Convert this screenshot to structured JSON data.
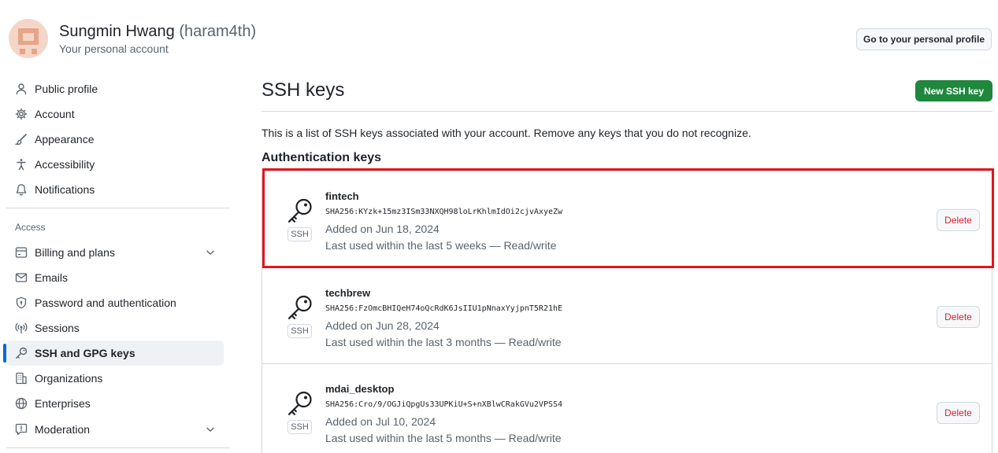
{
  "header": {
    "display_name": "Sungmin Hwang",
    "handle": "(haram4th)",
    "subtitle": "Your personal account",
    "profile_button": "Go to your personal profile"
  },
  "sidebar": {
    "items_top": [
      {
        "label": "Public profile",
        "icon": "person-icon"
      },
      {
        "label": "Account",
        "icon": "gear-icon"
      },
      {
        "label": "Appearance",
        "icon": "paintbrush-icon"
      },
      {
        "label": "Accessibility",
        "icon": "accessibility-icon"
      },
      {
        "label": "Notifications",
        "icon": "bell-icon"
      }
    ],
    "access_label": "Access",
    "items_access": [
      {
        "label": "Billing and plans",
        "icon": "credit-card-icon"
      },
      {
        "label": "Emails",
        "icon": "mail-icon"
      },
      {
        "label": "Password and authentication",
        "icon": "shield-lock-icon"
      },
      {
        "label": "Sessions",
        "icon": "broadcast-icon"
      },
      {
        "label": "SSH and GPG keys",
        "icon": "key-icon"
      },
      {
        "label": "Organizations",
        "icon": "organization-icon"
      },
      {
        "label": "Enterprises",
        "icon": "globe-icon"
      },
      {
        "label": "Moderation",
        "icon": "report-icon"
      }
    ],
    "active_item": "SSH and GPG keys"
  },
  "main": {
    "title": "SSH keys",
    "new_button": "New SSH key",
    "description": "This is a list of SSH keys associated with your account. Remove any keys that you do not recognize.",
    "section_title": "Authentication keys",
    "keys": [
      {
        "name": "fintech",
        "fingerprint": "SHA256:KYzk+15mz3ISm33NXQH98loLrKhlmIdOi2cjvAxyeZw",
        "added": "Added on Jun 18, 2024",
        "last_used": "Last used within the last 5 weeks — Read/write",
        "badge": "SSH",
        "delete": "Delete"
      },
      {
        "name": "techbrew",
        "fingerprint": "SHA256:FzOmcBHIQeH74oQcRdK6JsIIU1pNnaxYyjpnT5R21hE",
        "added": "Added on Jun 28, 2024",
        "last_used": "Last used within the last 3 months — Read/write",
        "badge": "SSH",
        "delete": "Delete"
      },
      {
        "name": "mdai_desktop",
        "fingerprint": "SHA256:Cro/9/OGJiQpgUs33UPKiU+S+nXBlwCRakGVu2VPSS4",
        "added": "Added on Jul 10, 2024",
        "last_used": "Last used within the last 5 months — Read/write",
        "badge": "SSH",
        "delete": "Delete"
      }
    ]
  },
  "colors": {
    "accent": "#0969da",
    "primary_button": "#1f883d",
    "danger": "#d1242f",
    "highlight_box": "#e3141c"
  }
}
